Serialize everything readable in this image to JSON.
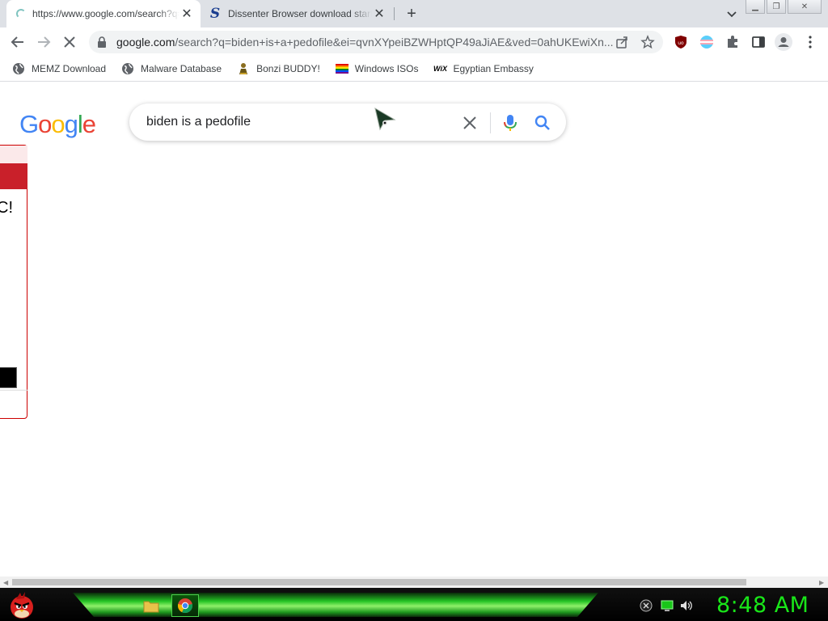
{
  "tabs": [
    {
      "title": "https://www.google.com/search?q=biden+is+a+pedofile",
      "favicon": "loading-spinner-icon",
      "active": true
    },
    {
      "title": "Dissenter Browser download start",
      "favicon": "dissenter-s-icon",
      "active": false
    }
  ],
  "toolbar": {
    "url_host": "google.com",
    "url_rest": "/search?q=biden+is+a+pedofile&ei=qvnXYpeiBZWHptQP49aJiAE&ved=0ahUKEwiXn..."
  },
  "bookmarks": [
    {
      "label": "MEMZ Download",
      "icon": "globe-icon"
    },
    {
      "label": "Malware Database",
      "icon": "globe-icon"
    },
    {
      "label": "Bonzi BUDDY!",
      "icon": "bonzi-icon"
    },
    {
      "label": "Windows ISOs",
      "icon": "rainbow-flag-icon"
    },
    {
      "label": "Egyptian Embassy",
      "icon": "wix-icon"
    }
  ],
  "page": {
    "logo": [
      "G",
      "o",
      "o",
      "g",
      "l",
      "e"
    ],
    "logo_colors": [
      "#4285F4",
      "#EA4335",
      "#FBBC05",
      "#4285F4",
      "#34A853",
      "#EA4335"
    ],
    "query": "biden is a pedofile"
  },
  "dialog": {
    "visible_text": "C!"
  },
  "taskbar": {
    "clock": "8:48 AM",
    "accent": "#19e619"
  }
}
